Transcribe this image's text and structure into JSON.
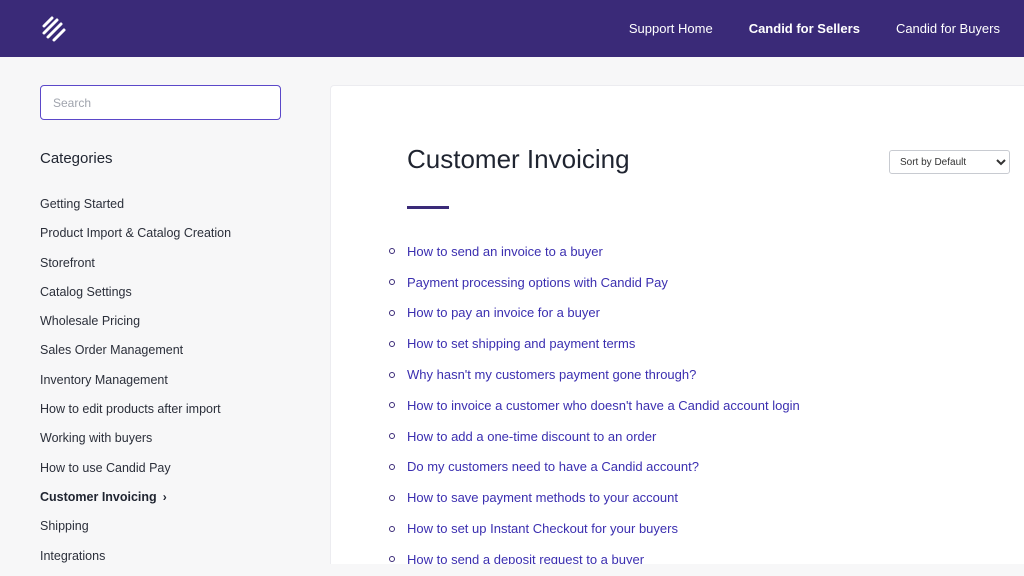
{
  "header": {
    "logo_icon": "candid-logo-icon",
    "nav": [
      {
        "label": "Support Home",
        "active": false
      },
      {
        "label": "Candid for Sellers",
        "active": true
      },
      {
        "label": "Candid for Buyers",
        "active": false
      }
    ]
  },
  "sidebar": {
    "search_placeholder": "Search",
    "categories_title": "Categories",
    "categories": [
      "Getting Started",
      "Product Import & Catalog Creation",
      "Storefront",
      "Catalog Settings",
      "Wholesale Pricing",
      "Sales Order Management",
      "Inventory Management",
      "How to edit products after import",
      "Working with buyers",
      "How to use Candid Pay",
      "Customer Invoicing",
      "Shipping",
      "Integrations"
    ],
    "active_category": "Customer Invoicing",
    "active_marker": "›"
  },
  "main": {
    "title": "Customer Invoicing",
    "sort_selected": "Sort by Default",
    "articles": [
      "How to send an invoice to a buyer",
      "Payment processing options with Candid Pay",
      "How to pay an invoice for a buyer",
      "How to set shipping and payment terms",
      "Why hasn't my customers payment gone through?",
      "How to invoice a customer who doesn't have a Candid account login",
      "How to add a one-time discount to an order",
      "Do my customers need to have a Candid account?",
      "How to save payment methods to your account",
      "How to set up Instant Checkout for your buyers",
      "How to send a deposit request to a buyer"
    ]
  },
  "colors": {
    "header_bg": "#3a2a78",
    "link": "#3b2fb0",
    "accent": "#5b48c9"
  }
}
